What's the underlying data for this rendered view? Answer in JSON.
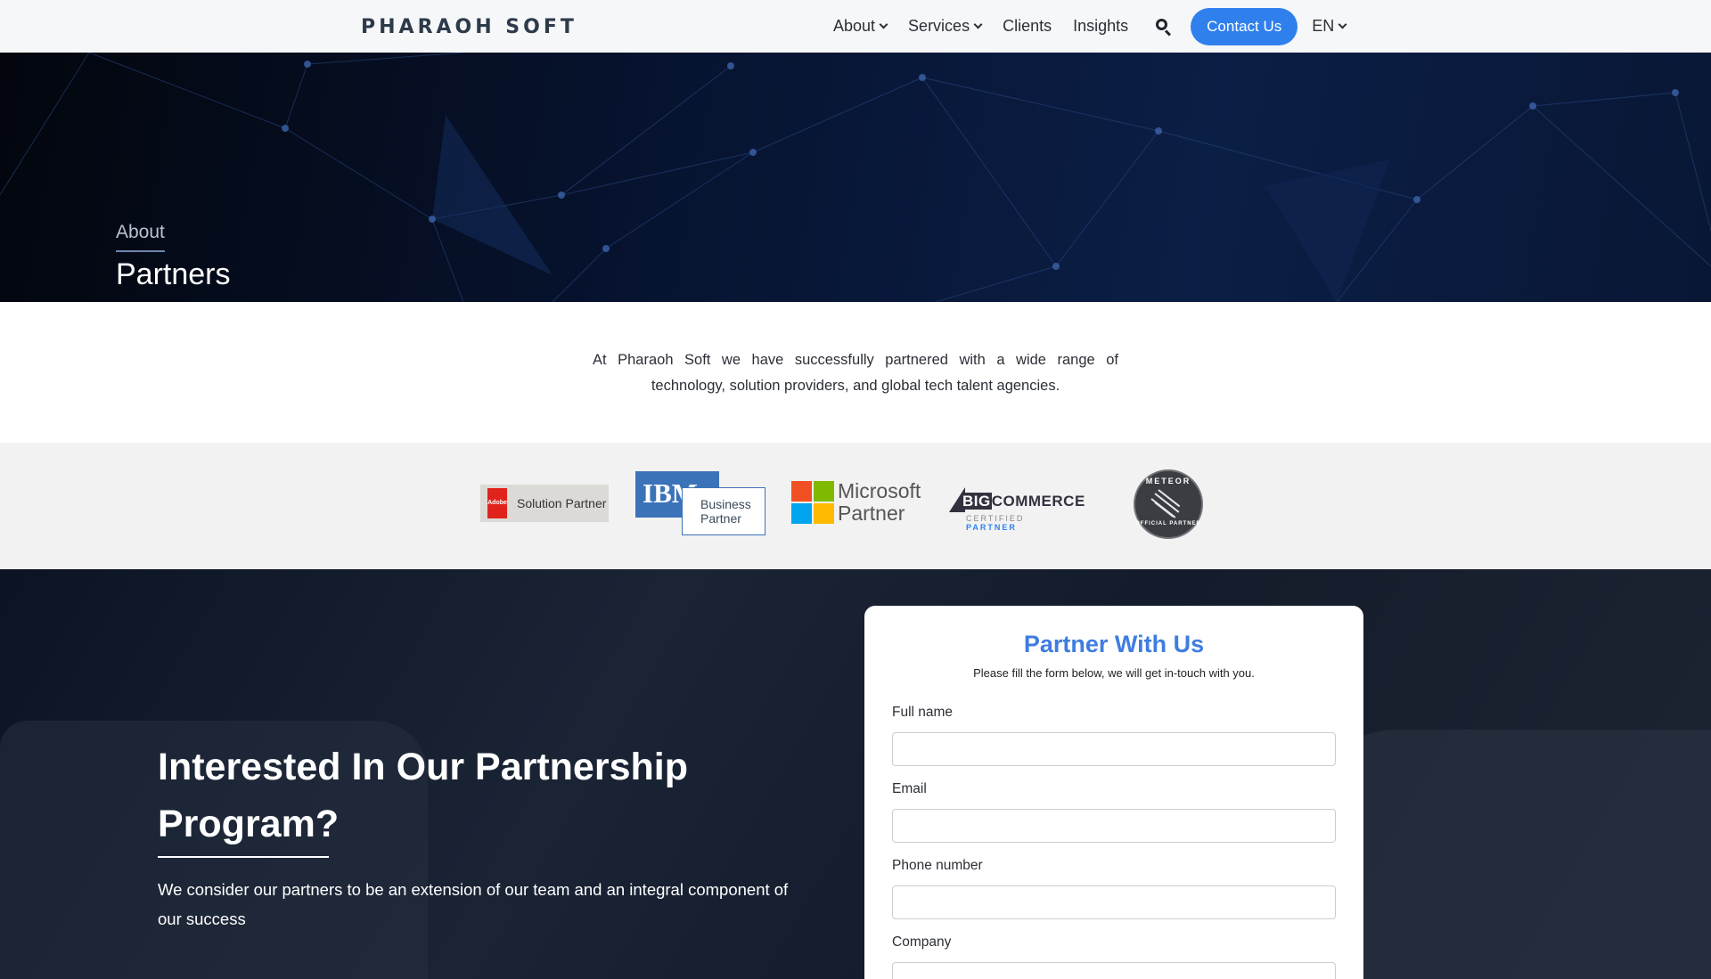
{
  "header": {
    "logo": "PHARAOH SOFT",
    "nav": [
      {
        "label": "About",
        "dropdown": true
      },
      {
        "label": "Services",
        "dropdown": true
      },
      {
        "label": "Clients",
        "dropdown": false
      },
      {
        "label": "Insights",
        "dropdown": false
      }
    ],
    "search_icon": "search-icon",
    "contact_label": "Contact Us",
    "language": "EN"
  },
  "hero": {
    "breadcrumb": "About",
    "title": "Partners"
  },
  "intro": {
    "text": "At Pharaoh Soft we have successfully partnered with a wide range of technology, solution providers, and global tech talent agencies."
  },
  "partners": {
    "adobe": {
      "label": "Solution Partner",
      "mark": "Adobe"
    },
    "ibm": {
      "brand": "IBM",
      "line1": "Business",
      "line2": "Partner"
    },
    "microsoft": {
      "line1": "Microsoft",
      "line2": "Partner"
    },
    "bigcommerce": {
      "brand_big": "BIG",
      "brand_rest": "COMMERCE",
      "sub_a": "CERTIFIED ",
      "sub_b": "PARTNER"
    },
    "meteor": {
      "top": "METEOR",
      "bottom": "OFFICIAL PARTNER"
    }
  },
  "cta": {
    "title": "Interested In Our Partnership Program?",
    "subtitle": "We consider our partners to be an extension of our team and an integral component of our success"
  },
  "form": {
    "title": "Partner With Us",
    "subtitle": "Please fill the form below, we will get in-touch with you.",
    "fields": [
      {
        "label": "Full name",
        "value": ""
      },
      {
        "label": "Email",
        "value": ""
      },
      {
        "label": "Phone number",
        "value": ""
      },
      {
        "label": "Company",
        "value": ""
      }
    ]
  },
  "colors": {
    "accent": "#2f80ed",
    "form_title": "#3f7de0",
    "hero_bg": "#071431"
  }
}
